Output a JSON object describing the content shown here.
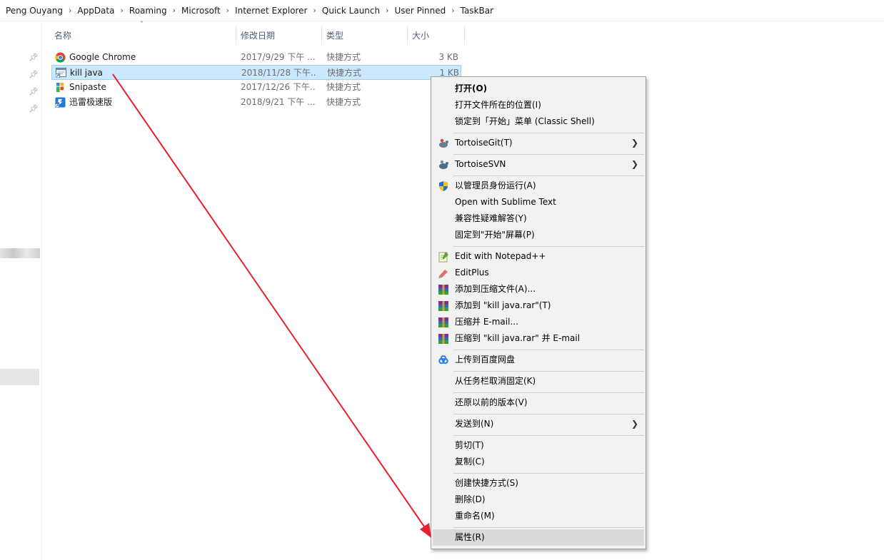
{
  "breadcrumb": [
    "Peng Ouyang",
    "AppData",
    "Roaming",
    "Microsoft",
    "Internet Explorer",
    "Quick Launch",
    "User Pinned",
    "TaskBar"
  ],
  "columns": {
    "name": "名称",
    "date": "修改日期",
    "type": "类型",
    "size": "大小"
  },
  "files": [
    {
      "name": "Google Chrome",
      "date": "2017/9/29 下午 ...",
      "type": "快捷方式",
      "size": "3 KB",
      "icon": "chrome-icon",
      "selected": false
    },
    {
      "name": "kill java",
      "date": "2018/11/28 下午...",
      "type": "快捷方式",
      "size": "1 KB",
      "icon": "shortcut-app-icon",
      "selected": true
    },
    {
      "name": "Snipaste",
      "date": "2017/12/26 下午...",
      "type": "快捷方式",
      "size": "",
      "icon": "snipaste-icon",
      "selected": false
    },
    {
      "name": "迅雷极速版",
      "date": "2018/9/21 下午 ...",
      "type": "快捷方式",
      "size": "",
      "icon": "thunder-icon",
      "selected": false
    }
  ],
  "context_menu": {
    "open": "打开(O)",
    "open_location": "打开文件所在的位置(I)",
    "pin_start_classic": "锁定到「开始」菜单 (Classic Shell)",
    "tortoisegit": "TortoiseGit(T)",
    "tortoisesvn": "TortoiseSVN",
    "run_as_admin": "以管理员身份运行(A)",
    "open_sublime": "Open with Sublime Text",
    "compat_troubleshoot": "兼容性疑难解答(Y)",
    "pin_start_screen": "固定到\"开始\"屏幕(P)",
    "edit_notepadpp": "Edit with Notepad++",
    "editplus": "EditPlus",
    "add_archive": "添加到压缩文件(A)...",
    "add_rar": "添加到 \"kill java.rar\"(T)",
    "compress_email": "压缩并 E-mail...",
    "compress_rar_email": "压缩到 \"kill java.rar\" 并 E-mail",
    "upload_baidu": "上传到百度网盘",
    "unpin_taskbar": "从任务栏取消固定(K)",
    "restore_versions": "还原以前的版本(V)",
    "send_to": "发送到(N)",
    "cut": "剪切(T)",
    "copy": "复制(C)",
    "create_shortcut": "创建快捷方式(S)",
    "delete": "删除(D)",
    "rename": "重命名(M)",
    "properties": "属性(R)"
  },
  "colors": {
    "selection": "#cce8ff",
    "menu_bg": "#f2f2f2",
    "menu_hover": "#dadada",
    "annotation_arrow": "#e8202a"
  }
}
